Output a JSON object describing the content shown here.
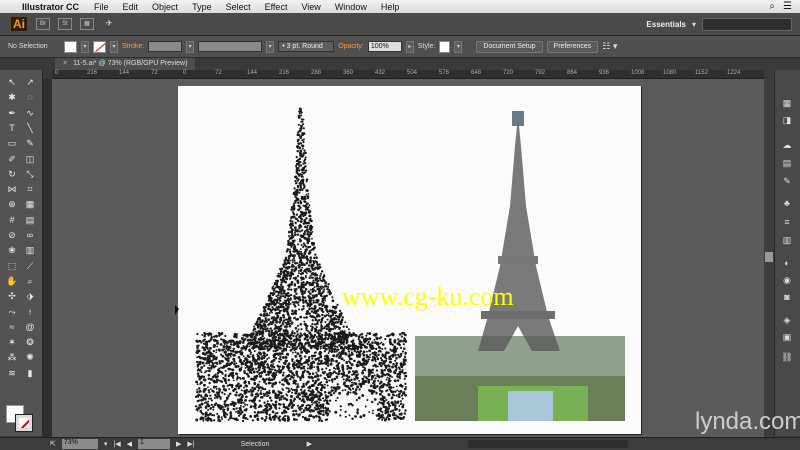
{
  "menubar": {
    "app": "Illustrator CC",
    "items": [
      "File",
      "Edit",
      "Object",
      "Type",
      "Select",
      "Effect",
      "View",
      "Window",
      "Help"
    ]
  },
  "appbar": {
    "logo": "Ai",
    "bridge": "Br",
    "stock": "St",
    "workspace": "Essentials"
  },
  "control": {
    "selection": "No Selection",
    "stroke_label": "Stroke:",
    "brush": "3 pt. Round",
    "opacity_label": "Opacity:",
    "opacity_value": "100%",
    "style_label": "Style:",
    "doc_setup": "Document Setup",
    "preferences": "Preferences"
  },
  "tab": {
    "close": "×",
    "title": "11-5.ai* @ 73% (RGB/GPU Preview)"
  },
  "ruler": [
    "0",
    "216",
    "144",
    "72",
    "0",
    "72",
    "144",
    "216",
    "288",
    "360",
    "432",
    "504",
    "576",
    "648",
    "720",
    "792",
    "864",
    "936",
    "1008",
    "1080",
    "1152",
    "1224"
  ],
  "watermark": "www.cg-ku.com",
  "brand": "lynda.com",
  "status": {
    "zoom": "73%",
    "page": "1",
    "tool": "Selection"
  },
  "colors": {
    "accent": "#ff9a00",
    "watermark": "#ffff00"
  }
}
